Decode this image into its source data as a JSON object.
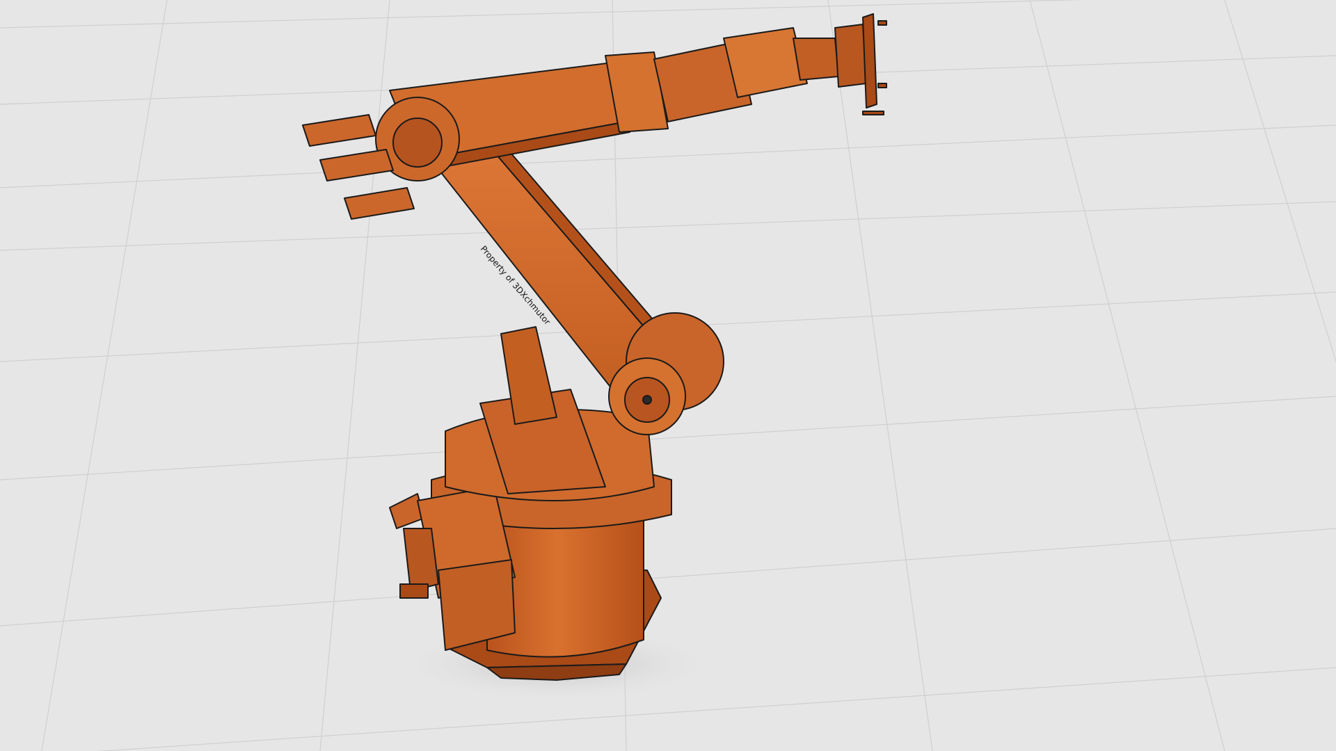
{
  "scene": {
    "floor_color": "#e6e6e6",
    "grid_color": "#cfcfcf",
    "robot_color": "#d2692a",
    "robot_dark": "#9c4518",
    "robot_light": "#e88a4a",
    "edge_color": "#1a1a1a",
    "arm_label": "Property of 3DXchmutor"
  }
}
